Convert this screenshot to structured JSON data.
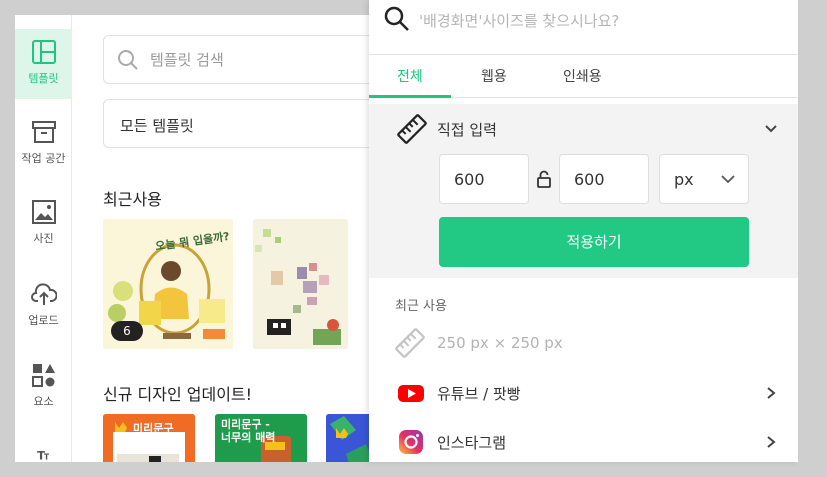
{
  "sidebar": {
    "items": [
      {
        "label": "템플릿",
        "icon": "layout-icon",
        "active": true
      },
      {
        "label": "작업 공간",
        "icon": "archive-box-icon"
      },
      {
        "label": "사진",
        "icon": "image-icon"
      },
      {
        "label": "업로드",
        "icon": "cloud-upload-icon"
      },
      {
        "label": "요소",
        "icon": "shapes-icon"
      },
      {
        "label": "",
        "icon": "text-icon"
      }
    ]
  },
  "main": {
    "search_placeholder": "템플릿 검색",
    "filter_value": "모든 템플릿",
    "recent_title": "최근사용",
    "recent_badge": "6",
    "recent_thumb_text": "오늘 뭐 입을까?",
    "new_title": "신규 디자인 업데이트!",
    "tiles": [
      {
        "text": "미리문구"
      },
      {
        "text": "미리문구 - 너무의 매력"
      },
      {
        "text": ""
      }
    ]
  },
  "dropdown": {
    "search_placeholder": "'배경화면'사이즈를 찾으시나요?",
    "tabs": [
      "전체",
      "웹용",
      "인쇄용"
    ],
    "active_tab": 0,
    "direct_input": {
      "title": "직접 입력",
      "width": "600",
      "height": "600",
      "unit": "px",
      "apply_label": "적용하기"
    },
    "recent_label": "최근 사용",
    "recent_size": "250 px × 250 px",
    "list": [
      {
        "label": "유튜브 / 팟빵",
        "icon": "youtube-icon"
      },
      {
        "label": "인스타그램",
        "icon": "instagram-icon"
      }
    ]
  },
  "colors": {
    "accent": "#20c57e",
    "apply_button": "#22c984",
    "active_bg": "#def5ea"
  }
}
